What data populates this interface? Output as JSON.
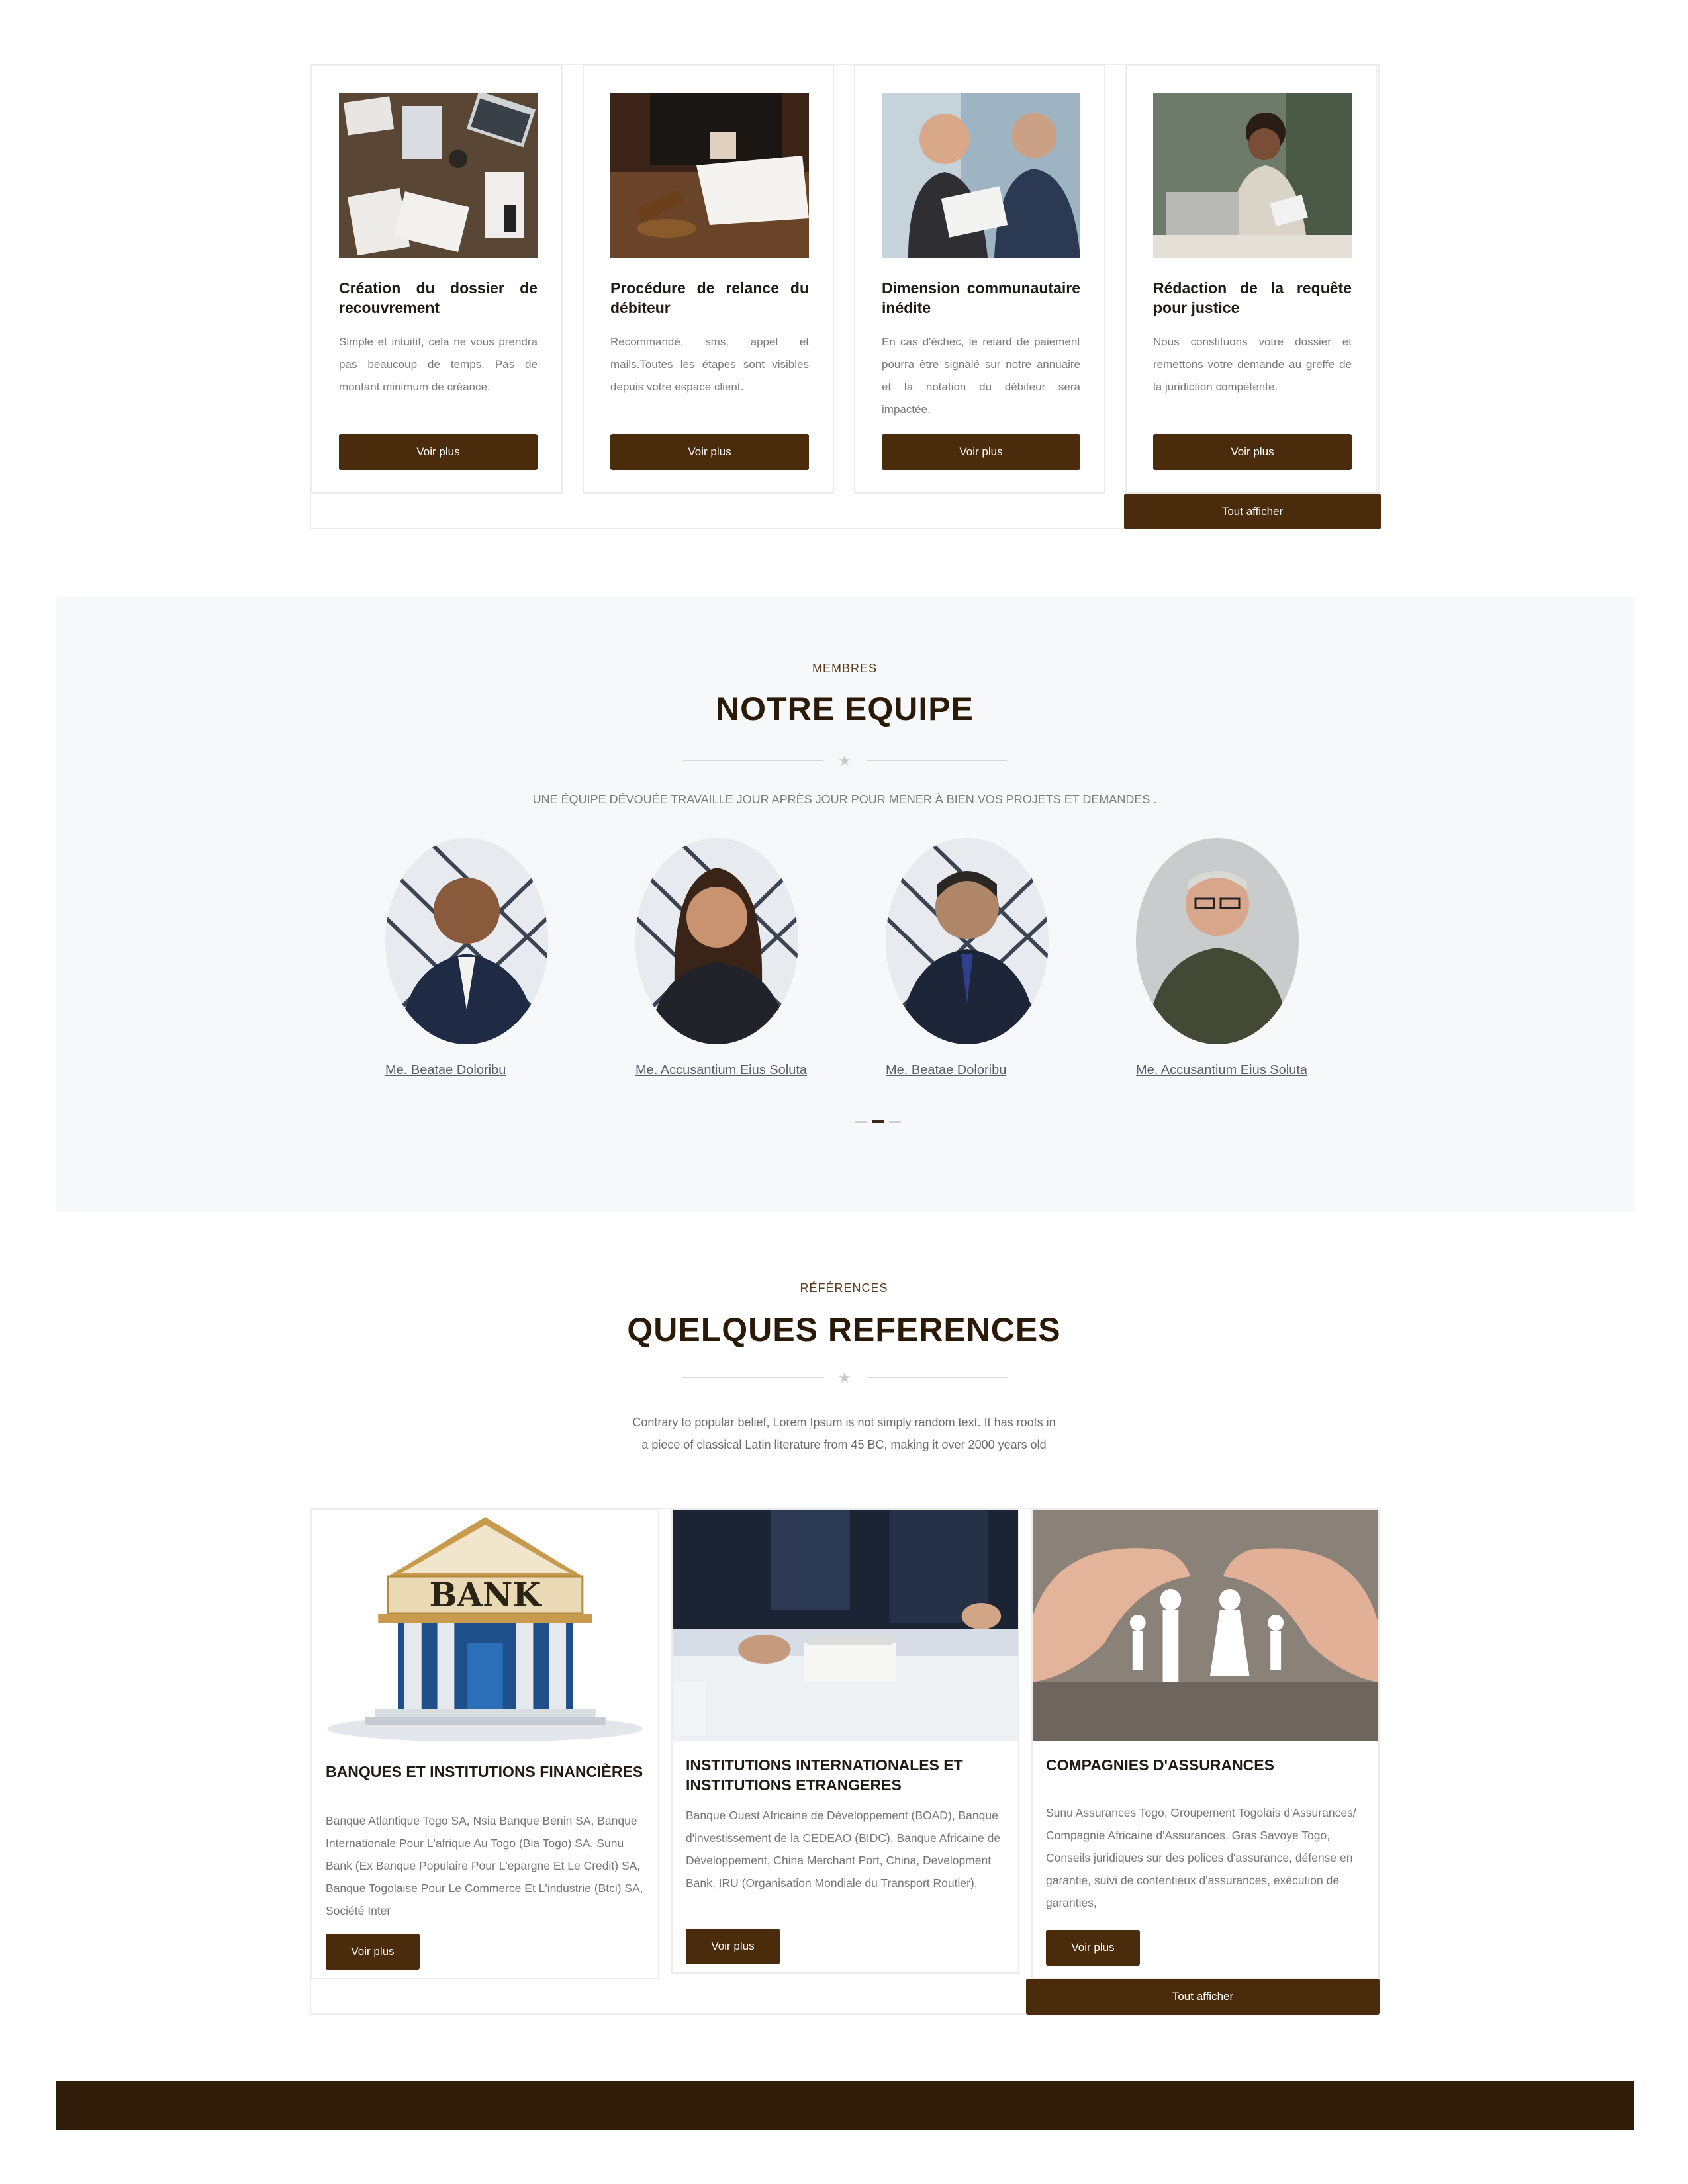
{
  "services": {
    "cards": [
      {
        "title": "Création du dossier de recouvrement",
        "description": "Simple et intuitif, cela ne vous prendra pas beaucoup de temps. Pas de montant minimum de créance.",
        "button": "Voir plus",
        "image": "desk-documents-photo"
      },
      {
        "title": "Procédure de relance du débiteur",
        "description": "Recommandé, sms, appel et mails.Toutes les étapes sont visibles depuis votre espace client.",
        "button": "Voir plus",
        "image": "gavel-signing-photo"
      },
      {
        "title": "Dimension communautaire inédite",
        "description": "En cas d'échec, le retard de paiement pourra être signalé sur notre annuaire et la notation du débiteur sera impactée.",
        "button": "Voir plus",
        "image": "business-meeting-photo"
      },
      {
        "title": "Rédaction de la requête pour justice",
        "description": "Nous constituons votre dossier et remettons votre demande au greffe de la juridiction compétente.",
        "button": "Voir plus",
        "image": "woman-laptop-photo"
      }
    ],
    "show_all": "Tout afficher"
  },
  "team": {
    "eyebrow": "MEMBRES",
    "title": "NOTRE EQUIPE",
    "subtitle": "UNE ÉQUIPE DÉVOUÉE TRAVAILLE JOUR APRÈS JOUR POUR MENER À BIEN VOS PROJETS ET DEMANDES .",
    "members": [
      {
        "name": "Me. Beatae Doloribu"
      },
      {
        "name": "Me. Accusantium Eius Soluta"
      },
      {
        "name": "Me. Beatae Doloribu"
      },
      {
        "name": "Me. Accusantium Eius Soluta"
      }
    ]
  },
  "references": {
    "eyebrow": "RÉFÉRENCES",
    "title": "QUELQUES REFERENCES",
    "intro": "Contrary to popular belief, Lorem Ipsum is not simply random text. It has roots in a piece of classical Latin literature from 45 BC, making it over 2000 years old",
    "cards": [
      {
        "title": "BANQUES ET INSTITUTIONS FINANCIÈRES",
        "description": "Banque Atlantique Togo SA, Nsia Banque Benin SA, Banque Internationale Pour L'afrique Au Togo (Bia Togo) SA, Sunu Bank (Ex Banque Populaire Pour L'epargne Et Le Credit) SA, Banque Togolaise Pour Le Commerce Et L'industrie (Btci) SA, Société Inter",
        "button": "Voir plus",
        "image_text": "BANK"
      },
      {
        "title": "INSTITUTIONS INTERNATIONALES ET INSTITUTIONS ETRANGERES",
        "description": "Banque Ouest Africaine de Développement (BOAD), Banque d'investissement de la CEDEAO (BIDC), Banque Africaine de Développement, China Merchant Port, China, Development Bank, IRU (Organisation Mondiale du Transport Routier),",
        "button": "Voir plus",
        "image": "documents-signing-photo"
      },
      {
        "title": "COMPAGNIES D'ASSURANCES",
        "description": "Sunu Assurances Togo, Groupement Togolais d'Assurances/ Compagnie Africaine d'Assurances, Gras Savoye Togo, Conseils juridiques sur des polices d'assurance, défense en garantie, suivi de contentieux d'assurances, exécution de garanties,",
        "button": "Voir plus",
        "image": "hands-protecting-family-photo"
      }
    ],
    "show_all": "Tout afficher"
  },
  "colors": {
    "brand_brown": "#4a2b0c",
    "title_dark": "#2b1a08",
    "footer": "#2f1d0a",
    "team_bg": "#f7f8f9"
  }
}
